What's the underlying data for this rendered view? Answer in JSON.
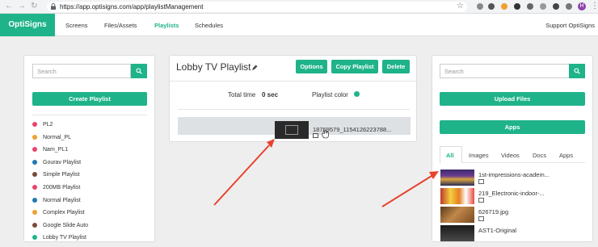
{
  "browser": {
    "url": "https://app.optisigns.com/app/playlistManagement",
    "profile_initial": "H"
  },
  "nav": {
    "brand": "OptiSigns",
    "links": [
      "Screens",
      "Files/Assets",
      "Playlists",
      "Schedules"
    ],
    "active": "Playlists",
    "support": "Support OptiSigns"
  },
  "left": {
    "search_placeholder": "Search",
    "create_label": "Create Playlist",
    "playlists": [
      {
        "name": "PL2",
        "color": "#e9446a"
      },
      {
        "name": "Normal_PL",
        "color": "#f0a030"
      },
      {
        "name": "Nam_PL1",
        "color": "#e9446a"
      },
      {
        "name": "Gourav Playlist",
        "color": "#1f78b4"
      },
      {
        "name": "Simple Playlist",
        "color": "#7b4a3a"
      },
      {
        "name": "200MB Playlist",
        "color": "#e9446a"
      },
      {
        "name": "Normal Playlist",
        "color": "#1f78b4"
      },
      {
        "name": "Complex Playlist",
        "color": "#f0a030"
      },
      {
        "name": "Google Slide Auto",
        "color": "#7b4a3a"
      },
      {
        "name": "Lobby TV Playlist",
        "color": "#1fb38a"
      }
    ]
  },
  "center": {
    "title": "Lobby TV Playlist",
    "options_label": "Options",
    "copy_label": "Copy Playlist",
    "delete_label": "Delete",
    "total_time_label": "Total time",
    "total_time_value": "0 sec",
    "color_label": "Playlist color",
    "color": "#1fb38a",
    "item_name": "18769579_1154126223788..."
  },
  "right": {
    "search_placeholder": "Search",
    "upload_label": "Upload Files",
    "apps_label": "Apps",
    "tabs": [
      "All",
      "Images",
      "Videos",
      "Docs",
      "Apps"
    ],
    "active_tab": "All",
    "assets": [
      {
        "name": "1st-impressions-academ..."
      },
      {
        "name": "219_Electronic-indoor-..."
      },
      {
        "name": "626719.jpg"
      },
      {
        "name": "AST1-Original"
      }
    ]
  },
  "colors": {
    "accent": "#1fb38a",
    "arrow": "#e8412c"
  }
}
